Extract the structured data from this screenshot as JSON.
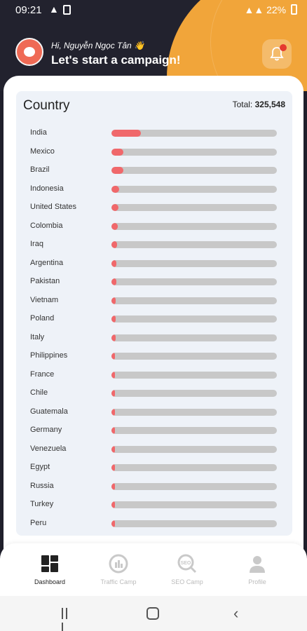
{
  "status_bar": {
    "time": "09:21",
    "battery": "22%"
  },
  "header": {
    "greeting": "Hi, Nguyễn Ngọc Tân 👋",
    "title": "Let's start a campaign!"
  },
  "card": {
    "title": "Country",
    "total_label": "Total:",
    "total_value": "325,548",
    "rows": [
      {
        "name": "India",
        "fraction": 0.18
      },
      {
        "name": "Mexico",
        "fraction": 0.07
      },
      {
        "name": "Brazil",
        "fraction": 0.07
      },
      {
        "name": "Indonesia",
        "fraction": 0.045
      },
      {
        "name": "United States",
        "fraction": 0.042
      },
      {
        "name": "Colombia",
        "fraction": 0.04
      },
      {
        "name": "Iraq",
        "fraction": 0.035
      },
      {
        "name": "Argentina",
        "fraction": 0.03
      },
      {
        "name": "Pakistan",
        "fraction": 0.028
      },
      {
        "name": "Vietnam",
        "fraction": 0.027
      },
      {
        "name": "Poland",
        "fraction": 0.025
      },
      {
        "name": "Italy",
        "fraction": 0.024
      },
      {
        "name": "Philippines",
        "fraction": 0.022
      },
      {
        "name": "France",
        "fraction": 0.02
      },
      {
        "name": "Chile",
        "fraction": 0.02
      },
      {
        "name": "Guatemala",
        "fraction": 0.018
      },
      {
        "name": "Germany",
        "fraction": 0.018
      },
      {
        "name": "Venezuela",
        "fraction": 0.017
      },
      {
        "name": "Egypt",
        "fraction": 0.016
      },
      {
        "name": "Russia",
        "fraction": 0.015
      },
      {
        "name": "Turkey",
        "fraction": 0.015
      },
      {
        "name": "Peru",
        "fraction": 0.014
      }
    ]
  },
  "nav": {
    "items": [
      {
        "label": "Dashboard",
        "icon": "dashboard-icon",
        "active": true
      },
      {
        "label": "Traffic Camp",
        "icon": "traffic-icon",
        "active": false
      },
      {
        "label": "SEO Camp",
        "icon": "seo-icon",
        "active": false
      },
      {
        "label": "Profile",
        "icon": "profile-icon",
        "active": false
      }
    ]
  },
  "colors": {
    "accent": "#f1a53a",
    "bar_fill": "#f0686b",
    "bar_track": "#c8c8c8",
    "header_bg": "#22222e"
  }
}
